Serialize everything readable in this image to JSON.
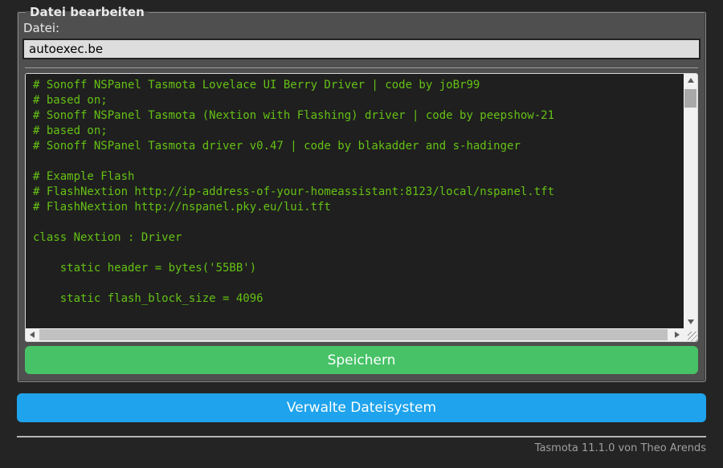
{
  "colors": {
    "body_bg": "#242424",
    "form_bg": "#4f4f4f",
    "text": "#eaeaea",
    "input_bg": "#dddddd",
    "input_text": "#000000",
    "console_bg": "#1f1f1f",
    "console_text": "#65c115",
    "button_text": "#faffff",
    "button_save_bg": "#47c266",
    "button_bg": "#1fa3ec",
    "footer_text": "#9f9f9f"
  },
  "form": {
    "legend": "Datei bearbeiten",
    "file_label": "Datei:",
    "filename": "autoexec.be",
    "save_label": "Speichern"
  },
  "editor": {
    "content": "# Sonoff NSPanel Tasmota Lovelace UI Berry Driver | code by joBr99\n# based on;\n# Sonoff NSPanel Tasmota (Nextion with Flashing) driver | code by peepshow-21\n# based on;\n# Sonoff NSPanel Tasmota driver v0.47 | code by blakadder and s-hadinger\n\n# Example Flash\n# FlashNextion http://ip-address-of-your-homeassistant:8123/local/nspanel.tft\n# FlashNextion http://nspanel.pky.eu/lui.tft\n\nclass Nextion : Driver\n\n    static header = bytes('55BB')\n\n    static flash_block_size = 4096\n"
  },
  "buttons": {
    "manage_fs": "Verwalte Dateisystem"
  },
  "footer": {
    "version": "Tasmota 11.1.0",
    "suffix": " von Theo Arends"
  }
}
